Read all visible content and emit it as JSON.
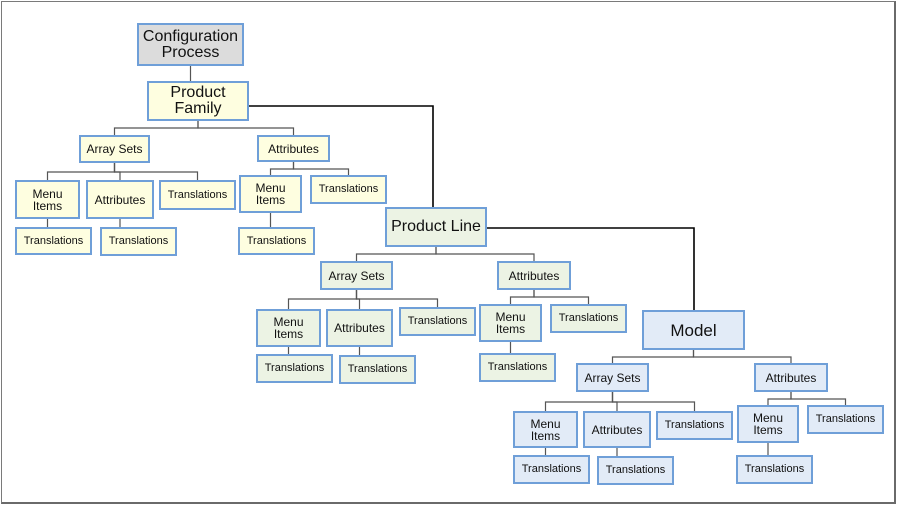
{
  "diagram": {
    "title": "Configuration Process",
    "nodes": [
      {
        "id": "config",
        "label": "Configuration\nProcess",
        "color": "gray",
        "size": "lg"
      },
      {
        "id": "pf",
        "label": "Product\nFamily",
        "color": "yellow",
        "size": "lg"
      },
      {
        "id": "pf_as",
        "label": "Array Sets",
        "color": "yellow",
        "size": "md"
      },
      {
        "id": "pf_attr",
        "label": "Attributes",
        "color": "yellow",
        "size": "md"
      },
      {
        "id": "pf_as_mi",
        "label": "Menu\nItems",
        "color": "yellow",
        "size": "md"
      },
      {
        "id": "pf_as_attr",
        "label": "Attributes",
        "color": "yellow",
        "size": "md"
      },
      {
        "id": "pf_as_tr",
        "label": "Translations",
        "color": "yellow",
        "size": "sm"
      },
      {
        "id": "pf_as_mi_tr",
        "label": "Translations",
        "color": "yellow",
        "size": "sm"
      },
      {
        "id": "pf_as_attr_tr",
        "label": "Translations",
        "color": "yellow",
        "size": "sm"
      },
      {
        "id": "pf_attr_mi",
        "label": "Menu\nItems",
        "color": "yellow",
        "size": "md"
      },
      {
        "id": "pf_attr_tr",
        "label": "Translations",
        "color": "yellow",
        "size": "sm"
      },
      {
        "id": "pf_attr_mi_tr",
        "label": "Translations",
        "color": "yellow",
        "size": "sm"
      },
      {
        "id": "pl",
        "label": "Product Line",
        "color": "green",
        "size": "lg"
      },
      {
        "id": "pl_as",
        "label": "Array Sets",
        "color": "green",
        "size": "md"
      },
      {
        "id": "pl_attr",
        "label": "Attributes",
        "color": "green",
        "size": "md"
      },
      {
        "id": "pl_as_mi",
        "label": "Menu\nItems",
        "color": "green",
        "size": "md"
      },
      {
        "id": "pl_as_attr",
        "label": "Attributes",
        "color": "green",
        "size": "md"
      },
      {
        "id": "pl_as_tr",
        "label": "Translations",
        "color": "green",
        "size": "sm"
      },
      {
        "id": "pl_as_mi_tr",
        "label": "Translations",
        "color": "green",
        "size": "sm"
      },
      {
        "id": "pl_as_attr_tr",
        "label": "Translations",
        "color": "green",
        "size": "sm"
      },
      {
        "id": "pl_attr_mi",
        "label": "Menu\nItems",
        "color": "green",
        "size": "md"
      },
      {
        "id": "pl_attr_tr",
        "label": "Translations",
        "color": "green",
        "size": "sm"
      },
      {
        "id": "pl_attr_mi_tr",
        "label": "Translations",
        "color": "green",
        "size": "sm"
      },
      {
        "id": "mo",
        "label": "Model",
        "color": "blue",
        "size": "xl"
      },
      {
        "id": "mo_as",
        "label": "Array Sets",
        "color": "blue",
        "size": "md"
      },
      {
        "id": "mo_attr",
        "label": "Attributes",
        "color": "blue",
        "size": "md"
      },
      {
        "id": "mo_as_mi",
        "label": "Menu\nItems",
        "color": "blue",
        "size": "md"
      },
      {
        "id": "mo_as_attr",
        "label": "Attributes",
        "color": "blue",
        "size": "md"
      },
      {
        "id": "mo_as_tr",
        "label": "Translations",
        "color": "blue",
        "size": "sm"
      },
      {
        "id": "mo_as_mi_tr",
        "label": "Translations",
        "color": "blue",
        "size": "sm"
      },
      {
        "id": "mo_as_attr_tr",
        "label": "Translations",
        "color": "blue",
        "size": "sm"
      },
      {
        "id": "mo_attr_mi",
        "label": "Menu\nItems",
        "color": "blue",
        "size": "md"
      },
      {
        "id": "mo_attr_tr",
        "label": "Translations",
        "color": "blue",
        "size": "sm"
      },
      {
        "id": "mo_attr_mi_tr",
        "label": "Translations",
        "color": "blue",
        "size": "sm"
      }
    ],
    "edges": [
      [
        "config",
        "pf"
      ],
      [
        "pf",
        "pf_as"
      ],
      [
        "pf",
        "pf_attr"
      ],
      [
        "pf_as",
        "pf_as_mi"
      ],
      [
        "pf_as",
        "pf_as_attr"
      ],
      [
        "pf_as",
        "pf_as_tr"
      ],
      [
        "pf_as_mi",
        "pf_as_mi_tr"
      ],
      [
        "pf_as_attr",
        "pf_as_attr_tr"
      ],
      [
        "pf_attr",
        "pf_attr_mi"
      ],
      [
        "pf_attr",
        "pf_attr_tr"
      ],
      [
        "pf_attr_mi",
        "pf_attr_mi_tr"
      ],
      [
        "pf",
        "pl"
      ],
      [
        "pl",
        "pl_as"
      ],
      [
        "pl",
        "pl_attr"
      ],
      [
        "pl_as",
        "pl_as_mi"
      ],
      [
        "pl_as",
        "pl_as_attr"
      ],
      [
        "pl_as",
        "pl_as_tr"
      ],
      [
        "pl_as_mi",
        "pl_as_mi_tr"
      ],
      [
        "pl_as_attr",
        "pl_as_attr_tr"
      ],
      [
        "pl_attr",
        "pl_attr_mi"
      ],
      [
        "pl_attr",
        "pl_attr_tr"
      ],
      [
        "pl_attr_mi",
        "pl_attr_mi_tr"
      ],
      [
        "pl",
        "mo"
      ],
      [
        "mo",
        "mo_as"
      ],
      [
        "mo",
        "mo_attr"
      ],
      [
        "mo_as",
        "mo_as_mi"
      ],
      [
        "mo_as",
        "mo_as_attr"
      ],
      [
        "mo_as",
        "mo_as_tr"
      ],
      [
        "mo_as_mi",
        "mo_as_mi_tr"
      ],
      [
        "mo_as_attr",
        "mo_as_attr_tr"
      ],
      [
        "mo_attr",
        "mo_attr_mi"
      ],
      [
        "mo_attr",
        "mo_attr_tr"
      ],
      [
        "mo_attr_mi",
        "mo_attr_mi_tr"
      ]
    ]
  }
}
